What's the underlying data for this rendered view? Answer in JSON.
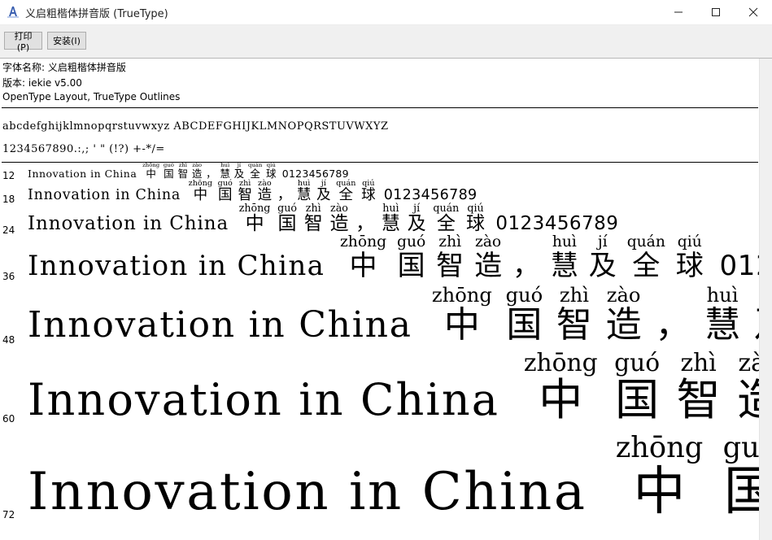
{
  "window": {
    "title": "义启粗楷体拼音版 (TrueType)",
    "minimize_glyph": "—",
    "maximize_glyph": "☐",
    "close_glyph": "✕"
  },
  "toolbar": {
    "print_label": "打印(P)",
    "install_label": "安装(I)"
  },
  "info": {
    "font_name": "字体名称: 义启粗楷体拼音版",
    "version": "版本: iekie v5.00",
    "outlines": "OpenType Layout, TrueType Outlines"
  },
  "charset": {
    "line1": "abcdefghijklmnopqrstuvwxyz ABCDEFGHIJKLMNOPQRSTUVWXYZ",
    "line2": "1234567890.:,; ' \" (!?) +-*/="
  },
  "sample": {
    "english": "Innovation in China",
    "hanzi": [
      "中",
      "国",
      "智",
      "造",
      "，",
      "慧",
      "及",
      "全",
      "球"
    ],
    "pinyin": [
      "zhōng",
      "guó",
      "zhì",
      "zào",
      "",
      "huì",
      "jí",
      "quán",
      "qiú"
    ],
    "digits": "0123456789"
  },
  "sizes": [
    {
      "label": "12"
    },
    {
      "label": "18"
    },
    {
      "label": "24"
    },
    {
      "label": "36"
    },
    {
      "label": "48"
    },
    {
      "label": "60"
    },
    {
      "label": "72"
    }
  ]
}
